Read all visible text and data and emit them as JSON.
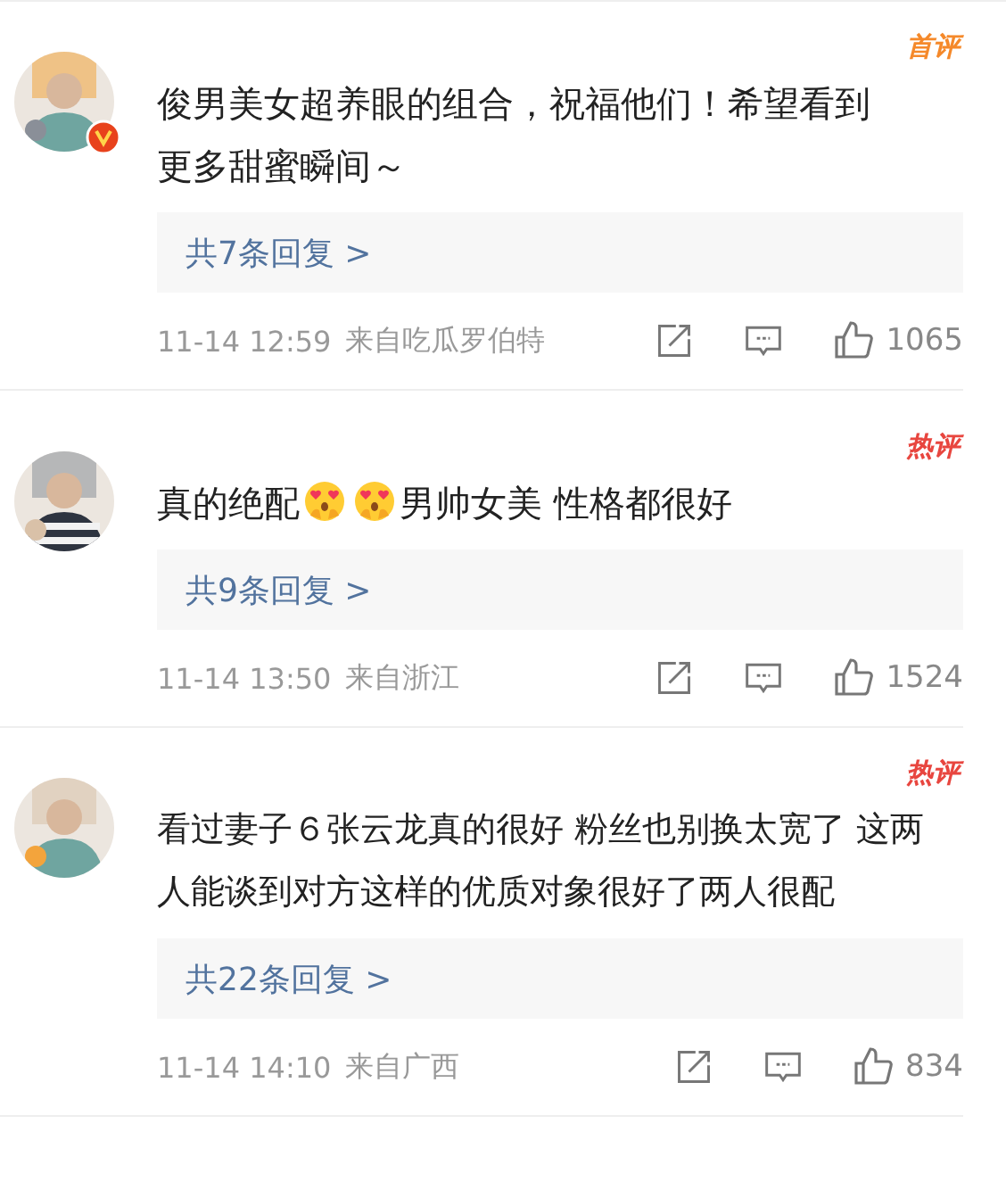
{
  "comments": [
    {
      "badge": {
        "text": "首评",
        "color": "#f5892a"
      },
      "verified": true,
      "body": [
        {
          "kind": "text",
          "text": "俊男美女超养眼的组合，祝福他们！希望看到更多甜蜜瞬间～"
        }
      ],
      "replies": "共7条回复 >",
      "time": "11-14 12:59",
      "source": "来自吃瓜罗伯特",
      "likes": "1065"
    },
    {
      "badge": {
        "text": "热评",
        "color": "#e8463f"
      },
      "verified": false,
      "body": [
        {
          "kind": "text",
          "text": "真的绝配"
        },
        {
          "kind": "emoji"
        },
        {
          "kind": "emoji"
        },
        {
          "kind": "text",
          "text": "男帅女美 性格都很好"
        }
      ],
      "replies": "共9条回复 >",
      "time": "11-14 13:50",
      "source": "来自浙江",
      "likes": "1524"
    },
    {
      "badge": {
        "text": "热评",
        "color": "#e8463f"
      },
      "verified": false,
      "body": [
        {
          "kind": "text",
          "text": "看过妻子６张云龙真的很好 粉丝也别换太宽了 这两人能谈到对方这样的优质对象很好了两人很配"
        }
      ],
      "replies": "共22条回复 >",
      "time": "11-14 14:10",
      "source": "来自广西",
      "likes": "834"
    }
  ]
}
